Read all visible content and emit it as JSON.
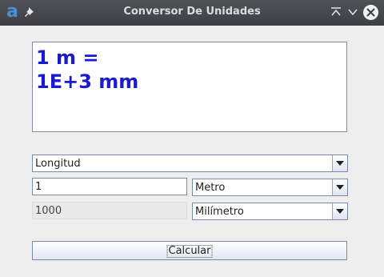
{
  "window": {
    "title": "Conversor De Unidades",
    "app_icon_glyph": "a",
    "icons": [
      "app-logo-icon",
      "pin-icon",
      "maximize-icon",
      "minimize-icon",
      "close-icon"
    ]
  },
  "display": {
    "line1": "1 m =",
    "line2": "1E+3 mm",
    "text_color": "#1a1ad0"
  },
  "form": {
    "category": {
      "selected": "Longitud"
    },
    "input": {
      "value": "1"
    },
    "from_unit": {
      "selected": "Metro"
    },
    "output": {
      "value": "1000"
    },
    "to_unit": {
      "selected": "Milímetro"
    },
    "calculate_label": "Calcular"
  }
}
